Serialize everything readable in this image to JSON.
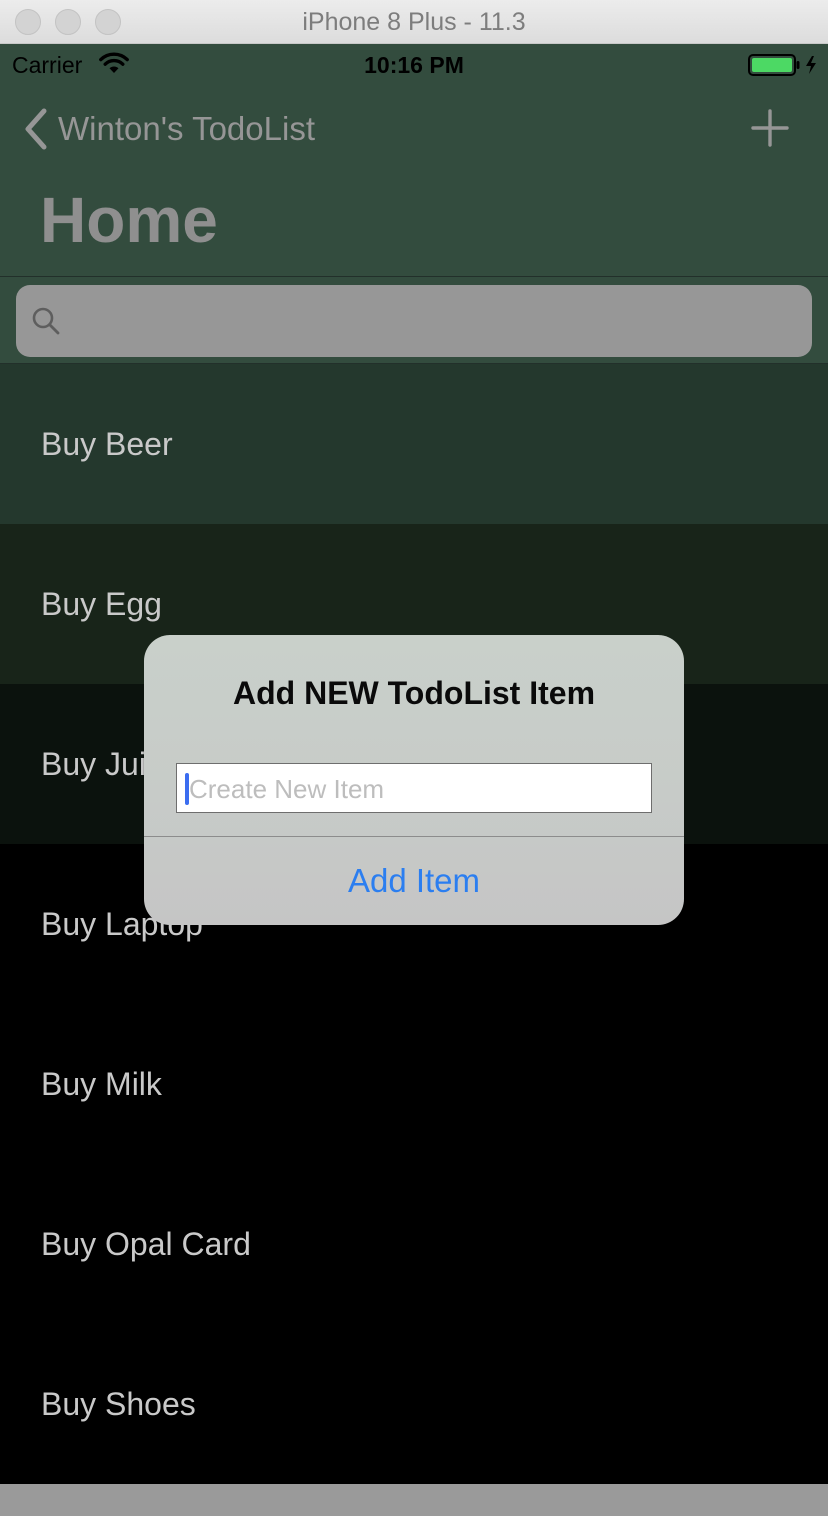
{
  "window": {
    "title": "iPhone 8 Plus - 11.3"
  },
  "status_bar": {
    "carrier": "Carrier",
    "time": "10:16 PM",
    "wifi_icon": "wifi-icon",
    "battery_icon": "battery-charging-icon",
    "battery_color": "#4cd964"
  },
  "nav": {
    "back_label": "Winton's TodoList",
    "back_icon": "chevron-left-icon",
    "add_icon": "plus-icon",
    "title": "Home",
    "bar_color": "#334c3e"
  },
  "search": {
    "placeholder": "",
    "icon": "search-icon"
  },
  "list": {
    "items": [
      {
        "label": "Buy Beer",
        "bg": "#24382d"
      },
      {
        "label": "Buy Egg",
        "bg": "#182419"
      },
      {
        "label": "Buy Juice",
        "bg": "#0b120d"
      },
      {
        "label": "Buy Laptop",
        "bg": "#000000"
      },
      {
        "label": "Buy Milk",
        "bg": "#000000"
      },
      {
        "label": "Buy Opal Card",
        "bg": "#000000"
      },
      {
        "label": "Buy Shoes",
        "bg": "#000000"
      }
    ]
  },
  "alert": {
    "title": "Add NEW TodoList Item",
    "input_placeholder": "Create New Item",
    "input_value": "",
    "action_label": "Add Item",
    "action_color": "#2b7ef0"
  }
}
